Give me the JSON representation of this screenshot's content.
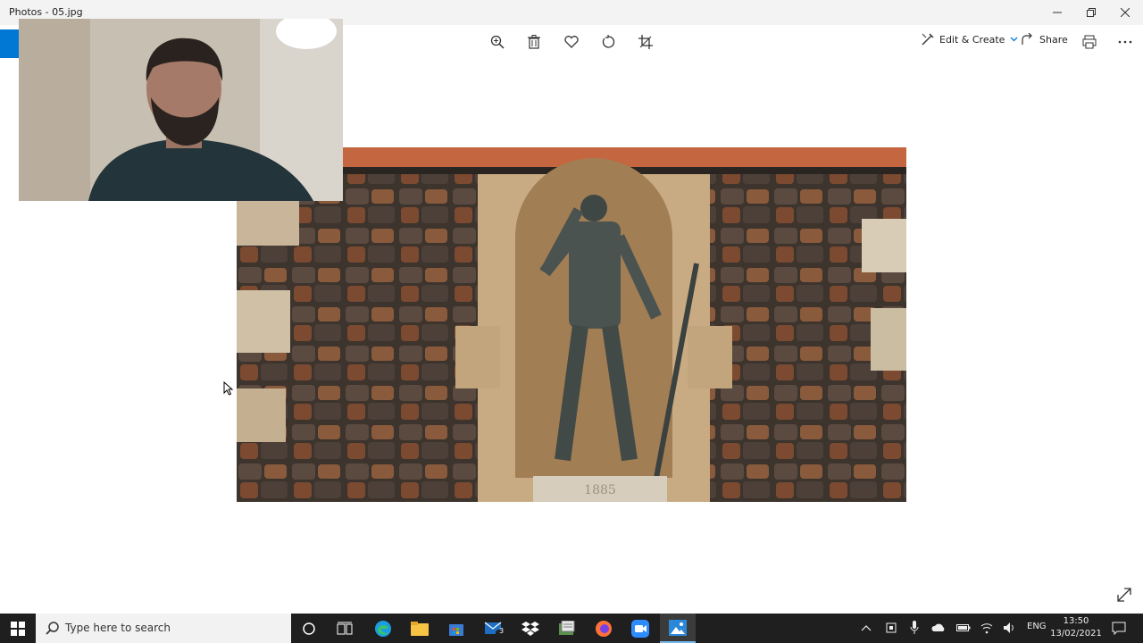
{
  "window": {
    "title": "Photos - 05.jpg",
    "controls": [
      "minimize",
      "restore",
      "close"
    ]
  },
  "toolbar": {
    "icons": [
      "zoom-icon",
      "delete-icon",
      "favorite-icon",
      "rotate-icon",
      "crop-icon"
    ],
    "edit_create_label": "Edit & Create",
    "share_label": "Share",
    "print_icon": "print-icon",
    "more_icon": "more-icon"
  },
  "photo": {
    "plaque_text": "1885"
  },
  "taskbar": {
    "search_placeholder": "Type here to search",
    "apps": [
      "cortana",
      "task-view",
      "edge",
      "file-explorer",
      "store",
      "mail",
      "dropbox",
      "files",
      "firefox",
      "zoom",
      "photos"
    ],
    "mail_badge": "3",
    "language": "ENG",
    "time": "13:50",
    "date": "13/02/2021"
  },
  "colors": {
    "accent": "#0078d4",
    "taskbar": "#1f1f1f"
  }
}
